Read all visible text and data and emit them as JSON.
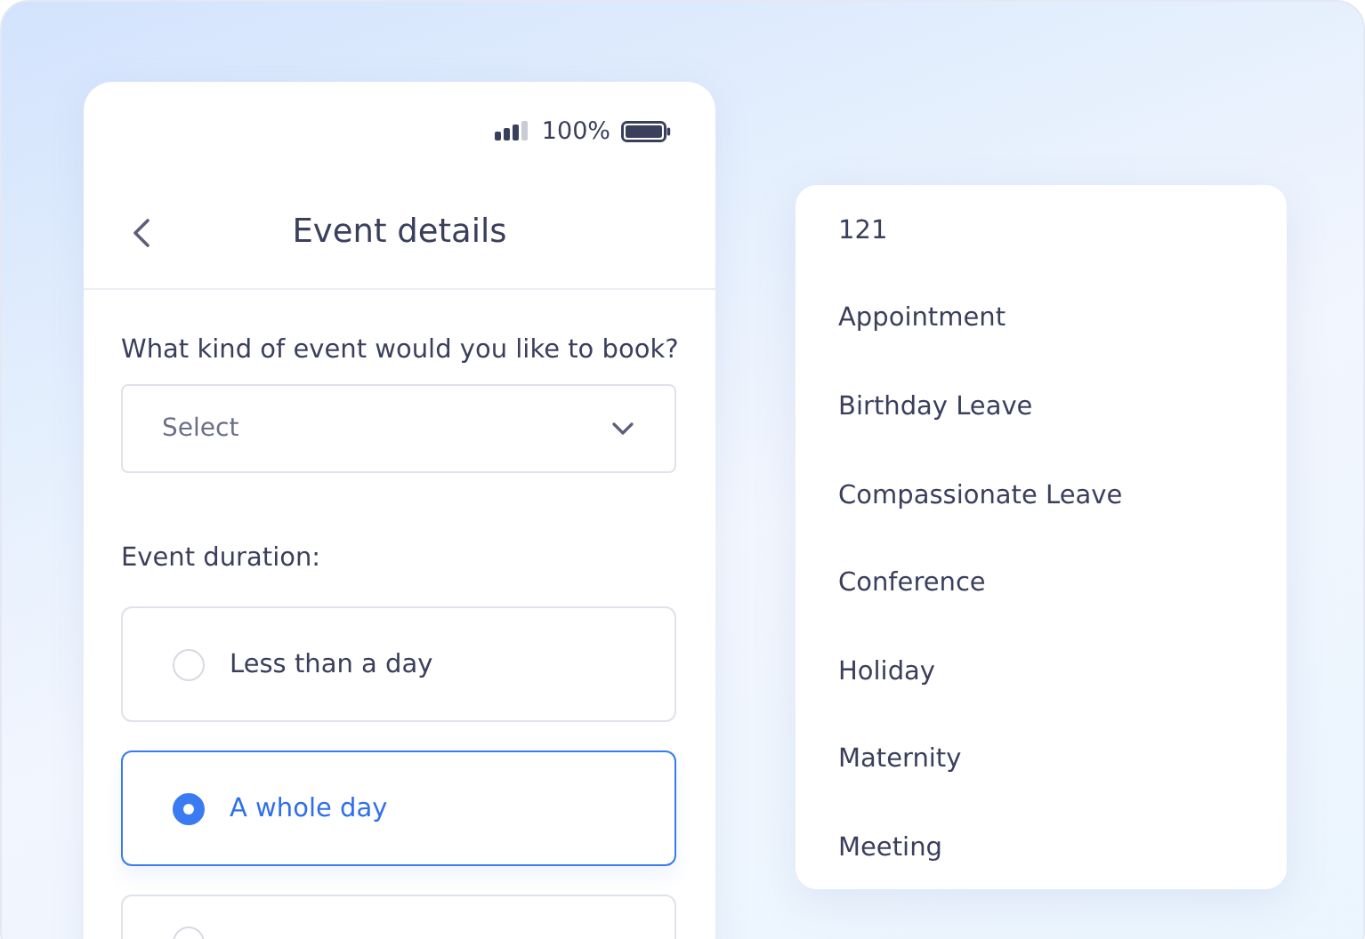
{
  "status_bar": {
    "battery": "100%"
  },
  "header": {
    "title": "Event details"
  },
  "event_type": {
    "question": "What kind of event would you like to book?",
    "placeholder": "Select"
  },
  "duration": {
    "label": "Event duration:",
    "options": [
      {
        "label": "Less than a day",
        "selected": false
      },
      {
        "label": "A whole day",
        "selected": true
      },
      {
        "selected": false
      }
    ]
  },
  "dropdown": {
    "items": [
      {
        "label": "121"
      },
      {
        "label": "Appointment"
      },
      {
        "label": "Birthday Leave"
      },
      {
        "label": "Compassionate Leave"
      },
      {
        "label": "Conference"
      },
      {
        "label": "Holiday"
      },
      {
        "label": "Maternity"
      },
      {
        "label": "Meeting"
      }
    ]
  }
}
